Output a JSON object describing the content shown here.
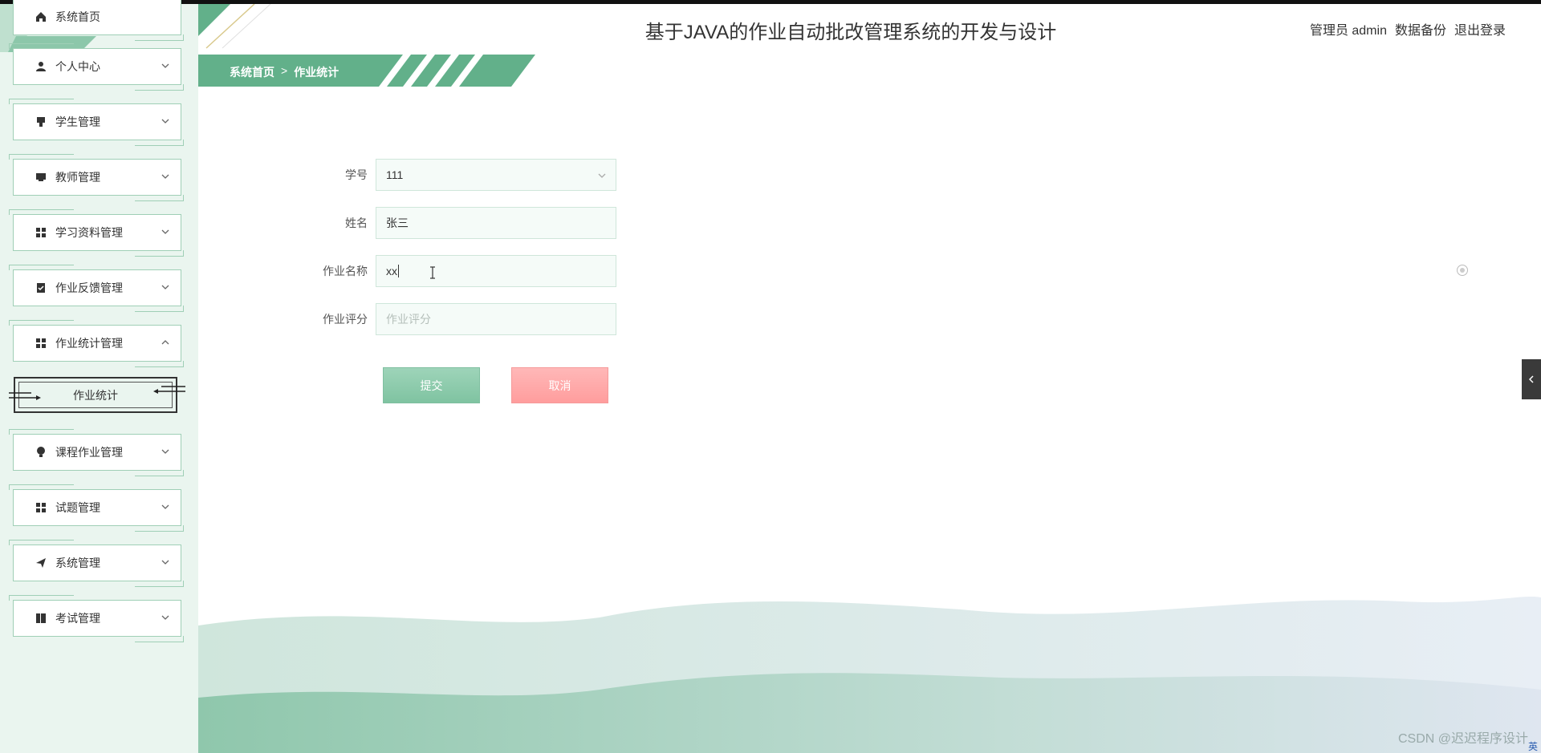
{
  "header": {
    "title": "基于JAVA的作业自动批改管理系统的开发与设计",
    "role_user": "管理员 admin",
    "backup": "数据备份",
    "logout": "退出登录"
  },
  "breadcrumb": {
    "home": "系统首页",
    "separator": ">",
    "current": "作业统计"
  },
  "sidebar": {
    "items": [
      {
        "label": "系统首页",
        "icon": "home-icon"
      },
      {
        "label": "个人中心",
        "icon": "user-icon"
      },
      {
        "label": "学生管理",
        "icon": "student-icon"
      },
      {
        "label": "教师管理",
        "icon": "teacher-icon"
      },
      {
        "label": "学习资料管理",
        "icon": "grid-icon"
      },
      {
        "label": "作业反馈管理",
        "icon": "clipboard-icon"
      },
      {
        "label": "作业统计管理",
        "icon": "grid-icon"
      },
      {
        "label": "课程作业管理",
        "icon": "bulb-icon"
      },
      {
        "label": "试题管理",
        "icon": "grid-icon"
      },
      {
        "label": "系统管理",
        "icon": "send-icon"
      },
      {
        "label": "考试管理",
        "icon": "book-icon"
      }
    ],
    "submenu_active": "作业统计"
  },
  "form": {
    "student_id": {
      "label": "学号",
      "value": "111"
    },
    "name": {
      "label": "姓名",
      "value": "张三"
    },
    "homework_name": {
      "label": "作业名称",
      "value": "xx"
    },
    "score": {
      "label": "作业评分",
      "placeholder": "作业评分"
    },
    "submit": "提交",
    "cancel": "取消"
  },
  "colors": {
    "accent_green": "#62b08a",
    "submit_green": "#8fcbad",
    "cancel_pink": "#ffa8a8",
    "sidebar_bg": "#eaf5ef"
  },
  "watermark": "CSDN @迟迟程序设计",
  "tray": {
    "lang": "英"
  }
}
